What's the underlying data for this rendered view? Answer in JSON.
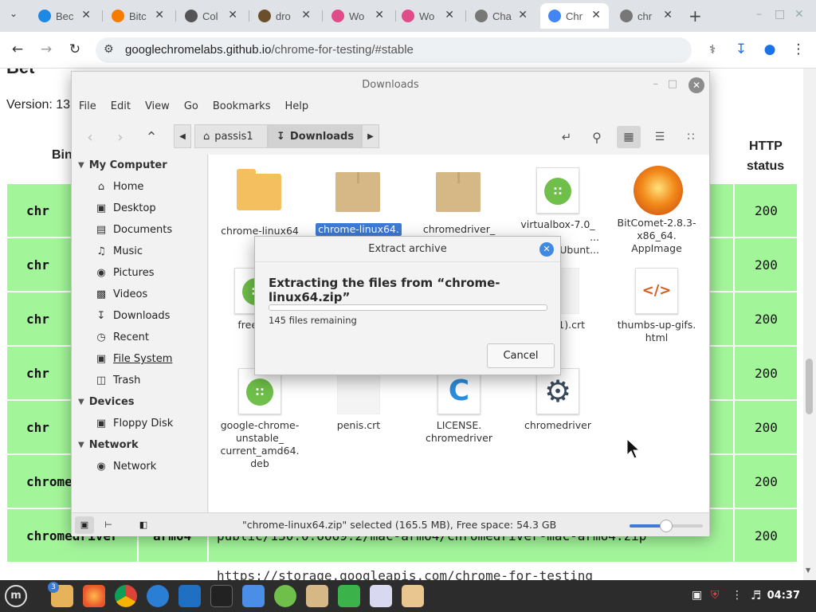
{
  "browser": {
    "tabs": [
      {
        "label": "Bec",
        "color": "#1e88e5"
      },
      {
        "label": "Bitc",
        "color": "#f57c00"
      },
      {
        "label": "Col",
        "color": "#555555"
      },
      {
        "label": "dro",
        "color": "#6b4f2a"
      },
      {
        "label": "Wo",
        "color": "#e04b8a"
      },
      {
        "label": "Wo",
        "color": "#e04b8a"
      },
      {
        "label": "Cha",
        "color": "#777777"
      },
      {
        "label": "Chr",
        "color": "#4285f4"
      },
      {
        "label": "chr",
        "color": "#777777"
      }
    ],
    "active_tab": 7,
    "new_tab": "+",
    "url_host": "googlechromelabs.github.io",
    "url_path": "/chrome-for-testing/#stable"
  },
  "webpage": {
    "partial_heading": "Bet",
    "version_label": "Version: 13",
    "col_binary": "Bin",
    "col_http": "HTTP",
    "col_status": "status",
    "rows": [
      {
        "binary": "chr",
        "status": "200"
      },
      {
        "binary": "chr",
        "status": "200"
      },
      {
        "binary": "chr",
        "status": "200"
      },
      {
        "binary": "chr",
        "status": "200"
      },
      {
        "binary": "chr",
        "status": "200"
      },
      {
        "binary": "chrome",
        "status": "200"
      },
      {
        "binary": "chromedriver",
        "platform": "arm64",
        "path": "public/130.0.6669.2/mac-arm64/chromedriver-mac-arm64.zip",
        "status": "200"
      }
    ],
    "last_row_partial": "https://storage.googleapis.com/chrome-for-testing"
  },
  "file_manager": {
    "title": "Downloads",
    "menu": [
      "File",
      "Edit",
      "View",
      "Go",
      "Bookmarks",
      "Help"
    ],
    "breadcrumb": [
      "passis1",
      "Downloads"
    ],
    "sidebar": {
      "my_computer": "My Computer",
      "places": [
        "Home",
        "Desktop",
        "Documents",
        "Music",
        "Pictures",
        "Videos",
        "Downloads",
        "Recent",
        "File System",
        "Trash"
      ],
      "devices": "Devices",
      "device_items": [
        "Floppy Disk"
      ],
      "network": "Network",
      "network_items": [
        "Network"
      ]
    },
    "files": [
      {
        "name": "chrome-linux64",
        "type": "folder"
      },
      {
        "name": "chrome-linux64.",
        "type": "archive",
        "selected": true
      },
      {
        "name": "chromedriver_",
        "type": "archive"
      },
      {
        "name": "virtualbox-7.0_",
        "name2": "...",
        "name3": "Ubunt...",
        "type": "package"
      },
      {
        "name": "BitComet-2.8.3-",
        "name2": "x86_64.",
        "name3": "AppImage",
        "type": "appimage"
      },
      {
        "name": "freedov",
        "name2": "nag",
        "type": "package"
      },
      {
        "name": "1).crt",
        "type": "cert"
      },
      {
        "name": "thumbs-up-gifs.",
        "name2": "html",
        "type": "html"
      },
      {
        "name": "google-chrome-",
        "name2": "unstable_",
        "name3": "current_amd64.",
        "name4": "deb",
        "type": "package"
      },
      {
        "name": "penis.crt",
        "type": "cert"
      },
      {
        "name": "LICENSE.",
        "name2": "chromedriver",
        "type": "text"
      },
      {
        "name": "chromedriver",
        "type": "exec"
      }
    ],
    "status": "\"chrome-linux64.zip\" selected (165.5 MB), Free space: 54.3 GB",
    "zoom_fraction": 0.5
  },
  "dialog": {
    "title": "Extract archive",
    "heading": "Extracting the files from “chrome-linux64.zip”",
    "progress": 0.0,
    "remaining": "145 files remaining",
    "cancel": "Cancel"
  },
  "taskbar": {
    "badge": "3",
    "time": "04:37"
  }
}
